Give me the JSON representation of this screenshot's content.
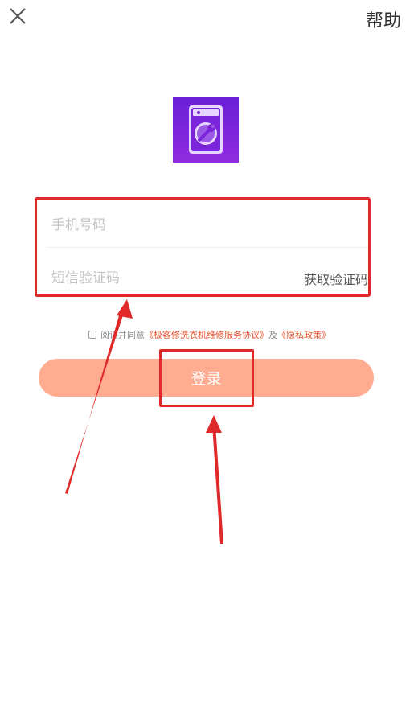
{
  "header": {
    "close_icon": "close-icon",
    "help_label": "帮助"
  },
  "logo": {
    "icon": "washing-machine-wrench-icon",
    "colors": {
      "top": "#6a1fd6",
      "bottom": "#8f2be0",
      "accent": "#e6d6ff"
    }
  },
  "form": {
    "phone_placeholder": "手机号码",
    "phone_value": "",
    "code_placeholder": "短信验证码",
    "code_value": "",
    "get_code_label": "获取验证码"
  },
  "agreement": {
    "checked": false,
    "prefix": "阅读并同意",
    "service_link": "《极客修洗衣机维修服务协议》",
    "conjunction": "及",
    "privacy_link": "《隐私政策》"
  },
  "login": {
    "label": "登录",
    "color": "#ffac91"
  },
  "annotations": {
    "highlight_color": "#e02a2a",
    "arrow_icon": "red-arrow"
  }
}
